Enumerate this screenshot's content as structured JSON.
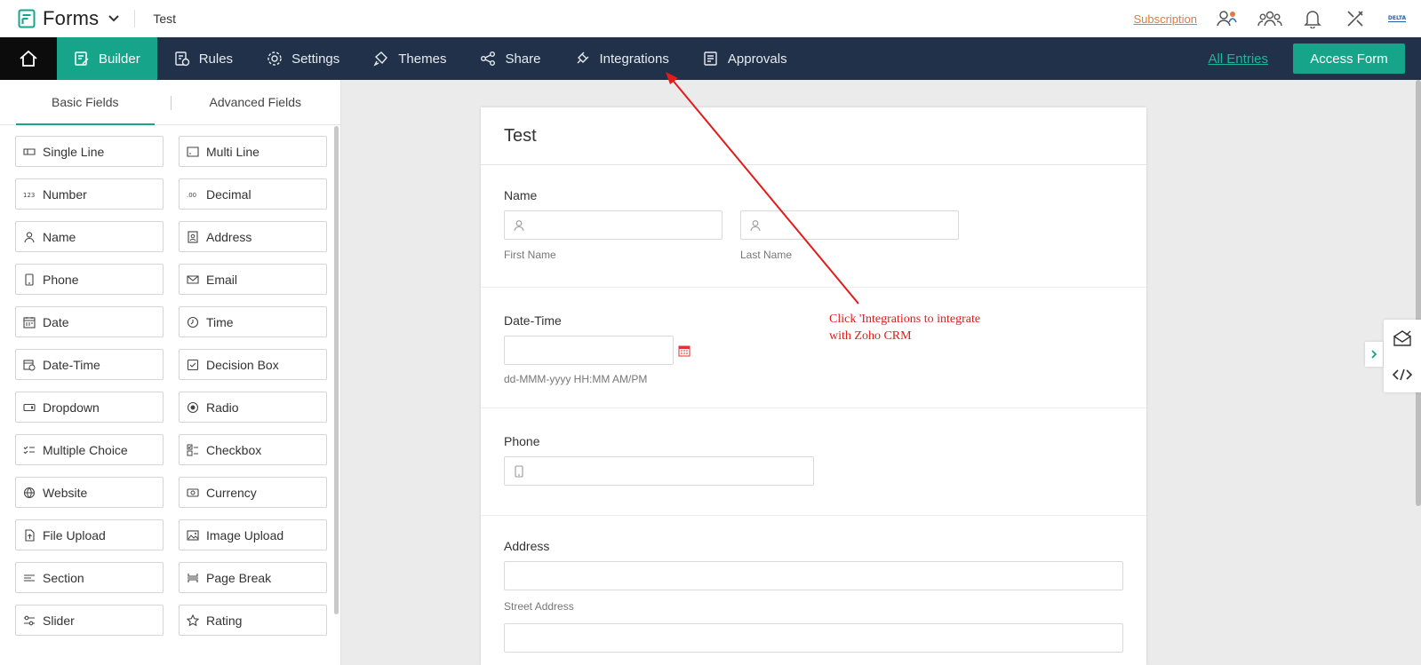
{
  "app": {
    "name": "Forms",
    "form_name": "Test",
    "subscription_label": "Subscription"
  },
  "top_icons": [
    "user-switch-icon",
    "team-icon",
    "bell-icon",
    "tools-icon",
    "brand-logo-icon"
  ],
  "nav": {
    "items": [
      {
        "label": "Builder",
        "icon": "builder-icon",
        "active": true
      },
      {
        "label": "Rules",
        "icon": "rules-icon"
      },
      {
        "label": "Settings",
        "icon": "gear-icon"
      },
      {
        "label": "Themes",
        "icon": "paint-icon"
      },
      {
        "label": "Share",
        "icon": "share-icon"
      },
      {
        "label": "Integrations",
        "icon": "plug-icon"
      },
      {
        "label": "Approvals",
        "icon": "approvals-icon"
      }
    ],
    "all_entries": "All Entries",
    "access_form": "Access Form"
  },
  "sidebar": {
    "tabs": [
      "Basic Fields",
      "Advanced Fields"
    ],
    "fields": [
      {
        "label": "Single Line",
        "icon": "single-line-icon"
      },
      {
        "label": "Multi Line",
        "icon": "multi-line-icon"
      },
      {
        "label": "Number",
        "icon": "number-icon"
      },
      {
        "label": "Decimal",
        "icon": "decimal-icon"
      },
      {
        "label": "Name",
        "icon": "person-icon"
      },
      {
        "label": "Address",
        "icon": "address-icon"
      },
      {
        "label": "Phone",
        "icon": "phone-icon"
      },
      {
        "label": "Email",
        "icon": "mail-icon"
      },
      {
        "label": "Date",
        "icon": "calendar-icon"
      },
      {
        "label": "Time",
        "icon": "clock-icon"
      },
      {
        "label": "Date-Time",
        "icon": "date-time-icon"
      },
      {
        "label": "Decision Box",
        "icon": "check-box-icon"
      },
      {
        "label": "Dropdown",
        "icon": "dropdown-icon"
      },
      {
        "label": "Radio",
        "icon": "radio-icon"
      },
      {
        "label": "Multiple Choice",
        "icon": "multiple-choice-icon"
      },
      {
        "label": "Checkbox",
        "icon": "checkbox-list-icon"
      },
      {
        "label": "Website",
        "icon": "globe-icon"
      },
      {
        "label": "Currency",
        "icon": "currency-icon"
      },
      {
        "label": "File Upload",
        "icon": "file-upload-icon"
      },
      {
        "label": "Image Upload",
        "icon": "image-upload-icon"
      },
      {
        "label": "Section",
        "icon": "section-icon"
      },
      {
        "label": "Page Break",
        "icon": "page-break-icon"
      },
      {
        "label": "Slider",
        "icon": "slider-icon"
      },
      {
        "label": "Rating",
        "icon": "star-icon"
      }
    ]
  },
  "form": {
    "title": "Test",
    "name_label": "Name",
    "first_name": "First Name",
    "last_name": "Last Name",
    "datetime_label": "Date-Time",
    "datetime_format": "dd-MMM-yyyy HH:MM AM/PM",
    "phone_label": "Phone",
    "address_label": "Address",
    "street_address": "Street Address"
  },
  "annotation": {
    "line1": "Click 'Integrations to integrate",
    "line2": "with Zoho CRM",
    "color": "#e21b1b"
  },
  "colors": {
    "accent": "#16a58b",
    "nav_bg": "#213149",
    "subscription": "#e07b3a"
  }
}
